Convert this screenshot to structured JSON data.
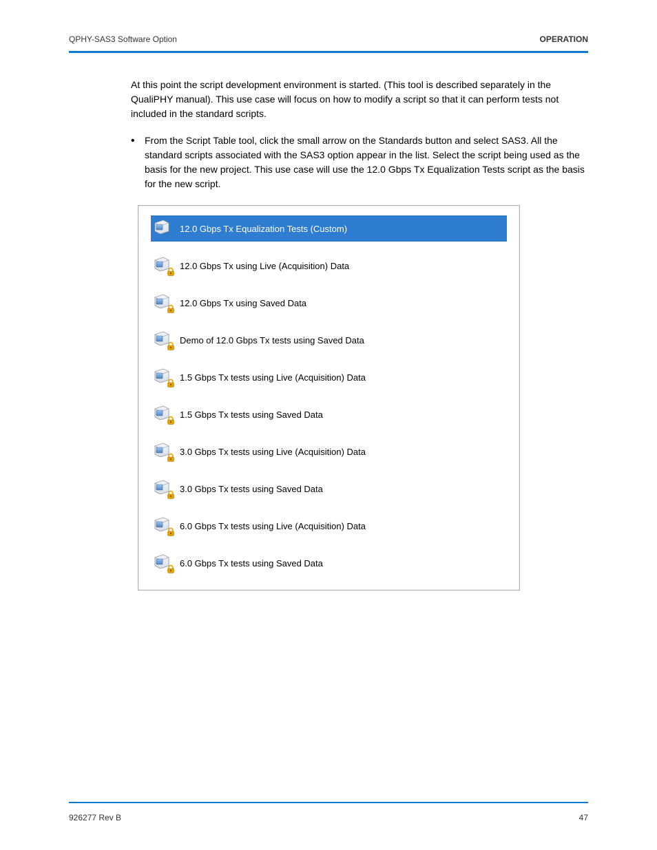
{
  "header": {
    "left": "QPHY-SAS3 Software Option",
    "right": "OPERATION"
  },
  "body": {
    "intro_paragraph": "At this point the script development environment is started. (This tool is described separately in the QualiPHY manual). This use case will focus on how to modify a script so that it can perform tests not included in the standard scripts.",
    "bullet_text": "From the Script Table tool, click the small arrow on the Standards button and select SAS3. All the standard scripts associated with the SAS3 option appear in the list. Select the script being used as the basis for the new project. This use case will use the 12.0 Gbps Tx Equalization Tests script as the basis for the new script."
  },
  "list": {
    "items": [
      {
        "label": "12.0 Gbps Tx Equalization Tests (Custom)",
        "locked": false,
        "selected": true
      },
      {
        "label": "12.0 Gbps Tx using Live (Acquisition) Data",
        "locked": true,
        "selected": false
      },
      {
        "label": "12.0 Gbps Tx using Saved Data",
        "locked": true,
        "selected": false
      },
      {
        "label": "Demo of 12.0 Gbps Tx tests using  Saved Data",
        "locked": true,
        "selected": false
      },
      {
        "label": "1.5 Gbps Tx tests using Live (Acquisition) Data",
        "locked": true,
        "selected": false
      },
      {
        "label": "1.5 Gbps Tx tests using Saved Data",
        "locked": true,
        "selected": false
      },
      {
        "label": "3.0 Gbps Tx tests using Live (Acquisition) Data",
        "locked": true,
        "selected": false
      },
      {
        "label": "3.0 Gbps Tx tests using Saved Data",
        "locked": true,
        "selected": false
      },
      {
        "label": "6.0 Gbps Tx tests using Live (Acquisition) Data",
        "locked": true,
        "selected": false
      },
      {
        "label": "6.0 Gbps Tx tests using Saved Data",
        "locked": true,
        "selected": false
      }
    ]
  },
  "footer": {
    "left": "926277 Rev B",
    "right": "47"
  },
  "colors": {
    "accent": "#0b79d0",
    "selection": "#2f7dd1",
    "lock": "#e5a200"
  }
}
